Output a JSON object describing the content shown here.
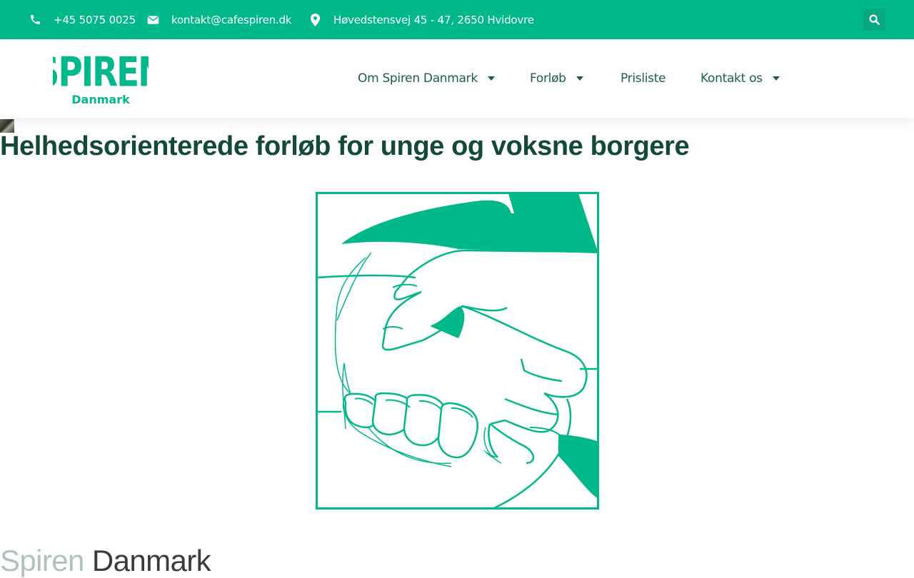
{
  "topbar": {
    "phone": "+45 5075 0025",
    "email": "kontakt@cafespiren.dk",
    "address": "Høvedstensvej 45 - 47, 2650 Hvidovre"
  },
  "logo": {
    "word": "SPIREN",
    "sub": "Danmark"
  },
  "nav": {
    "items": [
      {
        "label": "Om Spiren Danmark"
      },
      {
        "label": "Forløb"
      },
      {
        "label": "Prisliste"
      },
      {
        "label": "Kontakt os"
      }
    ]
  },
  "hero": {
    "title": "Helhedsorienterede forløb for unge og voksne borgere"
  },
  "footer": {
    "brand_part1": "Spiren",
    "brand_part2": "Danmark"
  },
  "colors": {
    "brand": "#00b88a",
    "heading": "#124a37",
    "nav_text": "#1d5c4a"
  },
  "icons": {
    "phone": "phone-icon",
    "email": "envelope-icon",
    "address": "map-pin-icon",
    "search": "search-icon"
  }
}
